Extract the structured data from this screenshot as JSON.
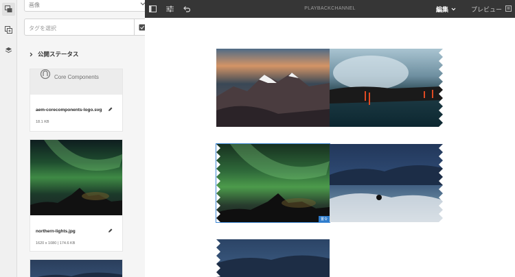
{
  "panel": {
    "asset_type": "画像",
    "tag_placeholder": "タグを選択",
    "publish_status_label": "公開ステータス",
    "cards": [
      {
        "logo_text": "Core Components",
        "name": "aem-corecomponents-logo.svg",
        "meta": "18.1 KB"
      },
      {
        "name": "northern-lights.jpg",
        "meta": "1620 x 1080 | 174.6 KB"
      },
      {
        "name": "",
        "meta": ""
      }
    ]
  },
  "topbar": {
    "title": "PLAYBACKCHANNEL",
    "edit_label": "編集",
    "preview_label": "プレビュー"
  },
  "canvas": {
    "selected_badge": "置令"
  },
  "colors": {
    "toolbar_bg": "#363636",
    "selection": "#3d87d5"
  }
}
